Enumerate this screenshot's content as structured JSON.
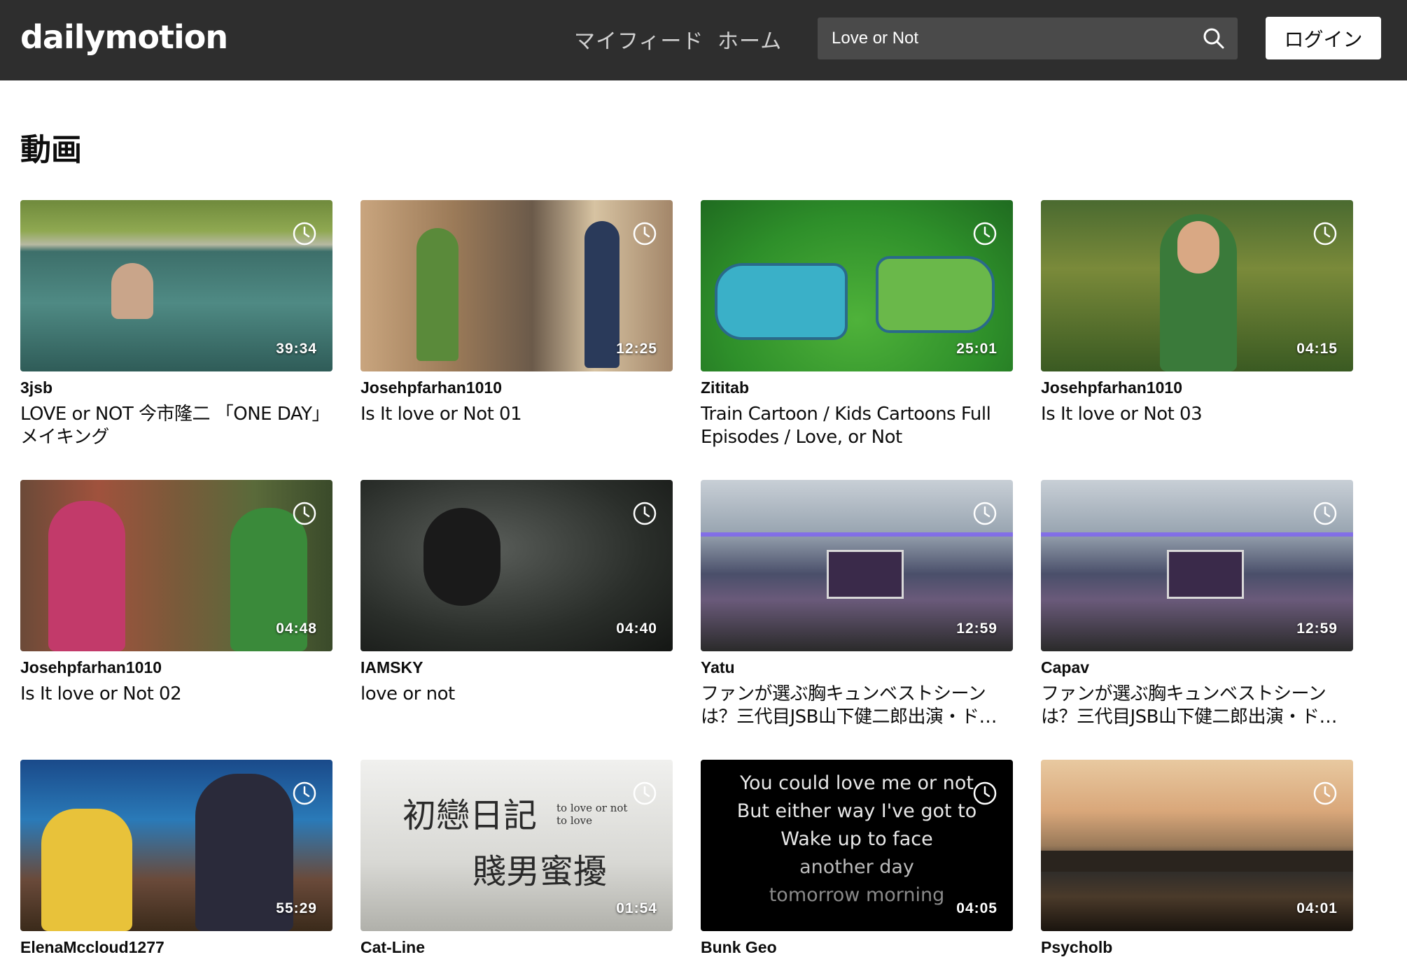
{
  "header": {
    "logo": "dailymotion",
    "nav": {
      "feed": "マイフィード",
      "home": "ホーム"
    },
    "search": {
      "value": "Love or Not"
    },
    "login_label": "ログイン"
  },
  "section": {
    "title": "動画"
  },
  "videos": [
    {
      "owner": "3jsb",
      "title": "LOVE or NOT 今市隆二 「ONE DAY」メイキング",
      "duration": "39:34"
    },
    {
      "owner": "Josehpfarhan1010",
      "title": "Is It love or Not 01",
      "duration": "12:25"
    },
    {
      "owner": "Zititab",
      "title": "Train Cartoon / Kids Cartoons Full Episodes / Love, or Not",
      "duration": "25:01"
    },
    {
      "owner": "Josehpfarhan1010",
      "title": "Is It love or Not 03",
      "duration": "04:15"
    },
    {
      "owner": "Josehpfarhan1010",
      "title": "Is It love or Not 02",
      "duration": "04:48"
    },
    {
      "owner": "IAMSKY",
      "title": "love or not",
      "duration": "04:40"
    },
    {
      "owner": "Yatu",
      "title": "ファンが選ぶ胸キュンベストシーンは？三代目JSB山下健二郎出演・ドラマ",
      "duration": "12:59"
    },
    {
      "owner": "Capav",
      "title": "ファンが選ぶ胸キュンベストシーンは？三代目JSB山下健二郎出演・ドラマ",
      "duration": "12:59"
    },
    {
      "owner": "ElenaMccloud1277",
      "title": "",
      "duration": "55:29"
    },
    {
      "owner": "Cat-Line",
      "title": "",
      "duration": "01:54"
    },
    {
      "owner": "Bunk Geo",
      "title": "",
      "duration": "04:05"
    },
    {
      "owner": "Psycholb",
      "title": "",
      "duration": "04:01"
    }
  ],
  "thumb_text": {
    "lyrics": [
      "You could love me or not",
      "But either way I've got to",
      "Wake up to face",
      "another day",
      "tomorrow morning"
    ],
    "kanji_line1": "初戀日記",
    "kanji_line2": "賤男蜜擾",
    "kanji_small": "to love or not to love"
  },
  "colors": {
    "header_bg": "#2e2e2e",
    "search_bg": "#4a4a4a",
    "text": "#0d0d0d"
  }
}
